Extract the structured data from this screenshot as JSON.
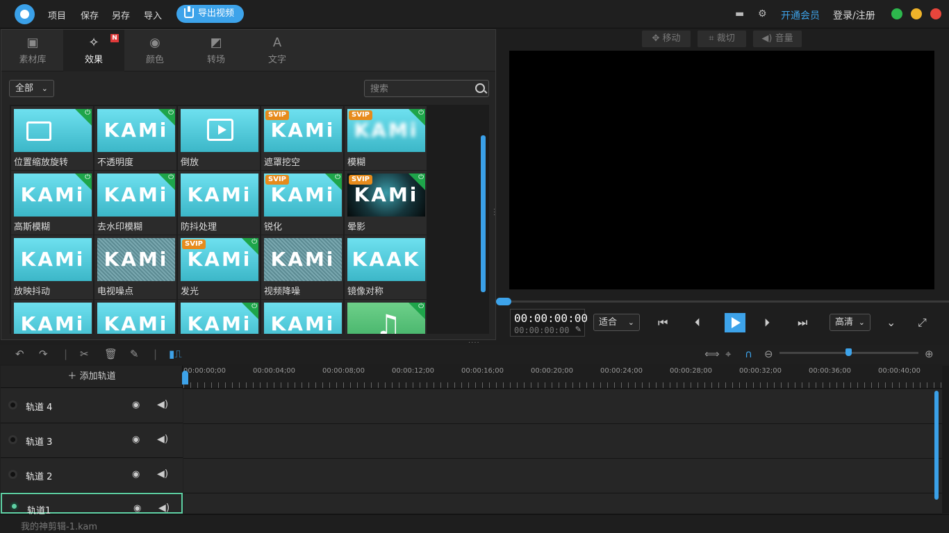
{
  "menu": {
    "project": "项目",
    "save": "保存",
    "save_as": "另存",
    "import": "导入",
    "export": "导出视频"
  },
  "header": {
    "vip": "开通会员",
    "login": "登录/注册"
  },
  "tabs": [
    {
      "label": "素材库",
      "icon": "media-library-icon"
    },
    {
      "label": "效果",
      "icon": "effects-icon",
      "badge": "N"
    },
    {
      "label": "颜色",
      "icon": "palette-icon"
    },
    {
      "label": "转场",
      "icon": "transition-icon"
    },
    {
      "label": "文字",
      "icon": "text-icon"
    }
  ],
  "filter": {
    "value": "全部"
  },
  "search": {
    "placeholder": "搜索"
  },
  "effects": [
    {
      "label": "位置缩放旋转",
      "thumb": "image",
      "svip": false,
      "free": true
    },
    {
      "label": "不透明度",
      "thumb": "kami",
      "svip": false,
      "free": true
    },
    {
      "label": "倒放",
      "thumb": "play",
      "svip": false,
      "free": false
    },
    {
      "label": "遮罩挖空",
      "thumb": "kami",
      "svip": true,
      "free": false
    },
    {
      "label": "模糊",
      "thumb": "blur",
      "svip": true,
      "free": true
    },
    {
      "label": "高斯模糊",
      "thumb": "kami",
      "svip": false,
      "free": true
    },
    {
      "label": "去水印模糊",
      "thumb": "kami",
      "svip": false,
      "free": true
    },
    {
      "label": "防抖处理",
      "thumb": "kami",
      "svip": false,
      "free": false
    },
    {
      "label": "锐化",
      "thumb": "kami",
      "svip": true,
      "free": true
    },
    {
      "label": "晕影",
      "thumb": "dark",
      "svip": true,
      "free": true
    },
    {
      "label": "放映抖动",
      "thumb": "kami",
      "svip": false,
      "free": false
    },
    {
      "label": "电视噪点",
      "thumb": "noise",
      "svip": false,
      "free": false
    },
    {
      "label": "发光",
      "thumb": "kami",
      "svip": true,
      "free": true
    },
    {
      "label": "视频降噪",
      "thumb": "noise",
      "svip": false,
      "free": false
    },
    {
      "label": "镜像对称",
      "thumb": "mirror",
      "svip": false,
      "free": false
    },
    {
      "label": "",
      "thumb": "kami",
      "svip": false,
      "free": false
    },
    {
      "label": "",
      "thumb": "kami",
      "svip": false,
      "free": false
    },
    {
      "label": "",
      "thumb": "kami",
      "svip": false,
      "free": true
    },
    {
      "label": "",
      "thumb": "kami",
      "svip": false,
      "free": false
    },
    {
      "label": "",
      "thumb": "music",
      "svip": false,
      "free": true
    }
  ],
  "thumb_text": "KAMi",
  "thumb_text_mirror": "KAAK",
  "svip_text": "SVIP",
  "preview": {
    "move": "移动",
    "crop": "裁切",
    "volume": "音量"
  },
  "timecode": {
    "main": "00:00:00:00",
    "sub": "00:00:00:00"
  },
  "fit": {
    "value": "适合"
  },
  "quality": {
    "value": "高清"
  },
  "timeline": {
    "add_track": "添加轨道",
    "ticks": [
      "00:00:00;00",
      "00:00:04;00",
      "00:00:08;00",
      "00:00:12;00",
      "00:00:16;00",
      "00:00:20;00",
      "00:00:24;00",
      "00:00:28;00",
      "00:00:32;00",
      "00:00:36;00",
      "00:00:40;00"
    ],
    "tracks": [
      "轨道 4",
      "轨道 3",
      "轨道 2",
      "轨道1"
    ]
  },
  "status": {
    "file": "我的神剪辑-1.kam"
  },
  "colors": {
    "accent": "#3da3ea",
    "free_badge": "#1ea54a",
    "svip": "#e78b1c",
    "active_track": "#5ed0a3"
  }
}
